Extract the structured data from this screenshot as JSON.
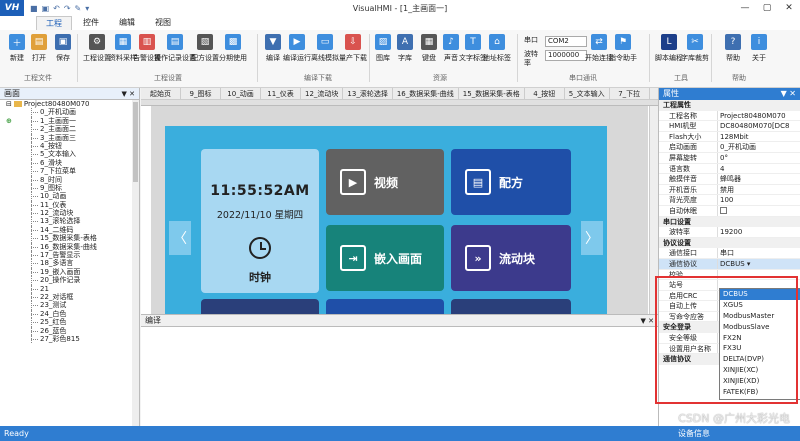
{
  "window": {
    "logo": "VH",
    "title": "VisualHMI - [1_主画面一]",
    "quick": [
      "■",
      "▣",
      "↶",
      "↷",
      "✎",
      "▾"
    ]
  },
  "menu_tabs": [
    "工程",
    "控件",
    "编辑",
    "视图"
  ],
  "ribbon": {
    "buttons": [
      {
        "label": "新建",
        "icon": "＋",
        "color": "#3e8ede"
      },
      {
        "label": "打开",
        "icon": "▤",
        "color": "#e0a03a"
      },
      {
        "label": "保存",
        "icon": "▣",
        "color": "#3e6fb0"
      },
      {
        "label": "工程设置",
        "icon": "⚙",
        "color": "#555"
      },
      {
        "label": "资料采样",
        "icon": "▦",
        "color": "#3e8ede"
      },
      {
        "label": "告警设置",
        "icon": "▥",
        "color": "#d9534f"
      },
      {
        "label": "操作记录设置",
        "icon": "▤",
        "color": "#3e8ede"
      },
      {
        "label": "配方设置",
        "icon": "▧",
        "color": "#555"
      },
      {
        "label": "分期使用",
        "icon": "▩",
        "color": "#3e8ede"
      },
      {
        "label": "编译",
        "icon": "▼",
        "color": "#3e6fb0"
      },
      {
        "label": "编译运行",
        "icon": "▶",
        "color": "#3e8ede"
      },
      {
        "label": "离线模拟",
        "icon": "▭",
        "color": "#3e8ede"
      },
      {
        "label": "量产下载",
        "icon": "⇩",
        "color": "#d9534f"
      },
      {
        "label": "图库",
        "icon": "▨",
        "color": "#3e8ede"
      },
      {
        "label": "字库",
        "icon": "A",
        "color": "#3e6fb0"
      },
      {
        "label": "键盘",
        "icon": "▦",
        "color": "#555"
      },
      {
        "label": "声音",
        "icon": "♪",
        "color": "#3e8ede"
      },
      {
        "label": "文字标签",
        "icon": "T",
        "color": "#3e8ede"
      },
      {
        "label": "地址标签",
        "icon": "⌂",
        "color": "#3e8ede"
      },
      {
        "label": "开始连接",
        "icon": "⇄",
        "color": "#3e8ede"
      },
      {
        "label": "指令助手",
        "icon": "⚑",
        "color": "#3e8ede"
      },
      {
        "label": "脚本编程",
        "icon": "L",
        "color": "#1d3f8a"
      },
      {
        "label": "字库裁剪",
        "icon": "✂",
        "color": "#3e8ede"
      },
      {
        "label": "帮助",
        "icon": "?",
        "color": "#3e6fb0"
      },
      {
        "label": "关于",
        "icon": "i",
        "color": "#3e8ede"
      }
    ],
    "groups": [
      "工程文件",
      "工程设置",
      "编译下载",
      "资源",
      "串口通讯",
      "工具",
      "帮助"
    ],
    "serial": {
      "port_label": "串口",
      "port_value": "COM2",
      "baud_label": "波特率",
      "baud_value": "1000000"
    }
  },
  "left_panel": {
    "title": "画面",
    "pin": "▼ ✕",
    "root": "Project80480M070",
    "items": [
      "0_开机动画",
      "1_主画面一",
      "2_主画面二",
      "3_主画面三",
      "4_按钮",
      "5_文本输入",
      "6_滑块",
      "7_下拉菜单",
      "8_时间",
      "9_图标",
      "10_动画",
      "11_仪表",
      "12_流动块",
      "13_滚轮选择",
      "14_二维码",
      "15_数据采集-表格",
      "16_数据采集-曲线",
      "17_告警显示",
      "18_多语言",
      "19_嵌入画面",
      "20_操作记录",
      "21",
      "22_对话框",
      "23_测试",
      "24_白色",
      "25_红色",
      "26_蓝色",
      "27_彩色815"
    ]
  },
  "screen_tabs": [
    "起始页",
    "9_图标",
    "10_动画",
    "11_仪表",
    "12_流动块",
    "13_滚轮选择",
    "16_数据采集-曲线",
    "15_数据采集-表格",
    "4_按钮",
    "5_文本输入",
    "7_下拉"
  ],
  "hmi": {
    "time": "11:55:52AM",
    "date": "2022/11/10 星期四",
    "clock_label": "时钟",
    "tiles": [
      {
        "label": "视频",
        "icon": "▶",
        "color": "#616161"
      },
      {
        "label": "配方",
        "icon": "▤",
        "color": "#1f4fa8"
      },
      {
        "label": "嵌入画面",
        "icon": "⇥",
        "color": "#17837a"
      },
      {
        "label": "流动块",
        "icon": "»",
        "color": "#3c3a8c"
      }
    ],
    "nav_left": "〈",
    "nav_right": "〉"
  },
  "compile_panel": {
    "title": "编译",
    "pin": "▼ ✕"
  },
  "right_panel": {
    "title": "属性",
    "pin": "▼ ✕",
    "rows": [
      {
        "t": "sect",
        "k": "工程属性"
      },
      {
        "k": "工程名称",
        "v": "Project80480M070"
      },
      {
        "k": "HMI机型",
        "v": "DC80480M070[DC8"
      },
      {
        "k": "Flash大小",
        "v": "128Mbit"
      },
      {
        "k": "启动画面",
        "v": "0_开机动画"
      },
      {
        "k": "屏幕旋转",
        "v": "0°"
      },
      {
        "k": "语言数",
        "v": "4"
      },
      {
        "k": "触摸伴音",
        "v": "蜂鸣器"
      },
      {
        "k": "开机音乐",
        "v": "禁用"
      },
      {
        "k": "背光亮度",
        "v": "100"
      },
      {
        "k": "自动休眠",
        "v": "",
        "chk": true
      },
      {
        "t": "sect",
        "k": "串口设置"
      },
      {
        "k": "波特率",
        "v": "19200"
      },
      {
        "t": "sect",
        "k": "协议设置"
      },
      {
        "k": "通信接口",
        "v": "串口"
      },
      {
        "k": "通信协议",
        "v": "DCBUS ▾",
        "sel": true
      },
      {
        "k": "校验",
        "v": ""
      },
      {
        "k": "站号",
        "v": ""
      },
      {
        "k": "启用CRC",
        "v": ""
      },
      {
        "k": "自动上传",
        "v": ""
      },
      {
        "k": "写命令应答",
        "v": ""
      },
      {
        "t": "sect",
        "k": "安全登录"
      },
      {
        "k": "安全等级",
        "v": ""
      },
      {
        "k": "设置用户名称",
        "v": ""
      },
      {
        "t": "sect",
        "k": "通信协议"
      }
    ],
    "dropdown": [
      "DCBUS",
      "XGUS",
      "ModbusMaster",
      "ModbusSlave",
      "FX2N",
      "FX3U",
      "DELTA(DVP)",
      "XINJIE(XC)",
      "XINJIE(XD)",
      "FATEK(FB)"
    ]
  },
  "status": {
    "left": "Ready",
    "mid": "设备信息"
  },
  "watermark": "CSDN @广州大彩光电"
}
